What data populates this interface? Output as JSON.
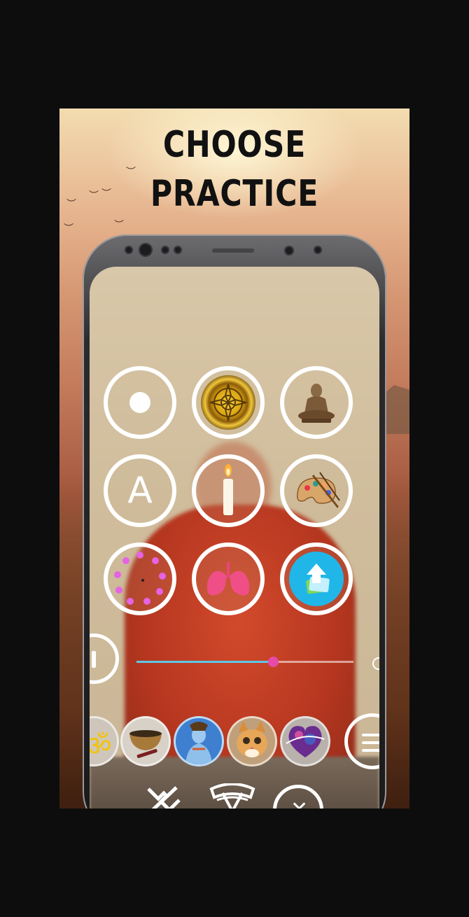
{
  "headline": {
    "line1": "CHOOSE",
    "line2": "PRACTICE"
  },
  "practice_grid": [
    {
      "name": "dot",
      "icon": "dot-icon"
    },
    {
      "name": "mandala",
      "icon": "mandala-icon"
    },
    {
      "name": "buddha",
      "icon": "buddha-statue-icon"
    },
    {
      "name": "letter",
      "icon": "letter-a-icon",
      "label": "A"
    },
    {
      "name": "candle",
      "icon": "candle-icon"
    },
    {
      "name": "palette",
      "icon": "paint-palette-icon"
    },
    {
      "name": "breath-clock",
      "icon": "breath-dots-icon"
    },
    {
      "name": "lungs",
      "icon": "lungs-icon"
    },
    {
      "name": "upload-image",
      "icon": "upload-image-icon"
    }
  ],
  "player": {
    "progress": 0.63
  },
  "sound_tray": [
    {
      "name": "om",
      "icon": "om-icon"
    },
    {
      "name": "singing-bowl",
      "icon": "singing-bowl-icon"
    },
    {
      "name": "shiva",
      "icon": "shiva-icon"
    },
    {
      "name": "kitten",
      "icon": "kitten-icon"
    },
    {
      "name": "cosmic-heart",
      "icon": "cosmic-heart-icon"
    }
  ],
  "colors": {
    "accent_blue": "#5ec7e6",
    "accent_pink": "#e84aa9",
    "ring": "#ffffff"
  }
}
